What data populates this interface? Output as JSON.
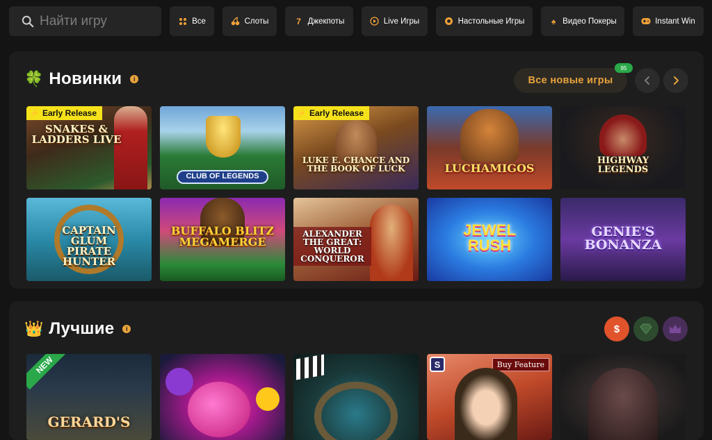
{
  "search": {
    "placeholder": "Найти игру"
  },
  "categories": [
    {
      "label": "Все",
      "icon": "grid-icon"
    },
    {
      "label": "Слоты",
      "icon": "cherry-icon"
    },
    {
      "label": "Джекпоты",
      "icon": "seven-icon"
    },
    {
      "label": "Live Игры",
      "icon": "play-icon"
    },
    {
      "label": "Настольные Игры",
      "icon": "chip-icon"
    },
    {
      "label": "Видео Покеры",
      "icon": "spade-icon"
    },
    {
      "label": "Instant Win",
      "icon": "gamepad-icon"
    }
  ],
  "new_section": {
    "title": "Новинки",
    "icon": "clover-icon",
    "all_new_button": "Все новые игры",
    "new_count": "95",
    "early_release_label": "Early Release",
    "games": [
      {
        "title": "SNAKES & LADDERS LIVE",
        "early_release": true
      },
      {
        "title": "CLUB OF LEGENDS",
        "early_release": false
      },
      {
        "title": "LUKE E. CHANCE AND THE BOOK OF LUCK",
        "early_release": true
      },
      {
        "title": "LUCHAMIGOS",
        "early_release": false
      },
      {
        "title": "HIGHWAY LEGENDS",
        "early_release": false
      },
      {
        "title": "CAPTAIN GLUM PIRATE HUNTER",
        "early_release": false
      },
      {
        "title": "BUFFALO BLITZ MEGAMERGE",
        "early_release": false
      },
      {
        "title": "ALEXANDER THE GREAT: WORLD CONQUEROR",
        "early_release": false
      },
      {
        "title": "JEWEL RUSH",
        "early_release": false
      },
      {
        "title": "GENIE'S BONANZA",
        "early_release": false
      }
    ]
  },
  "best_section": {
    "title": "Лучшие",
    "icon": "crown-icon",
    "filters": [
      {
        "name": "money-bag-filter",
        "color": "#e0532b"
      },
      {
        "name": "diamond-filter",
        "color": "#2d4a2e"
      },
      {
        "name": "crown-filter",
        "color": "#4a2e5a"
      }
    ],
    "new_ribbon": "NEW",
    "buy_feature": "Buy Feature",
    "games": [
      {
        "title": "GERARD'S"
      },
      {
        "title": ""
      },
      {
        "title": ""
      },
      {
        "title": ""
      },
      {
        "title": ""
      }
    ]
  },
  "colors": {
    "accent": "#e8a33b",
    "panel": "#1d1d1d",
    "background": "#141414",
    "chip": "#252525",
    "early_release": "#f6e21a"
  }
}
